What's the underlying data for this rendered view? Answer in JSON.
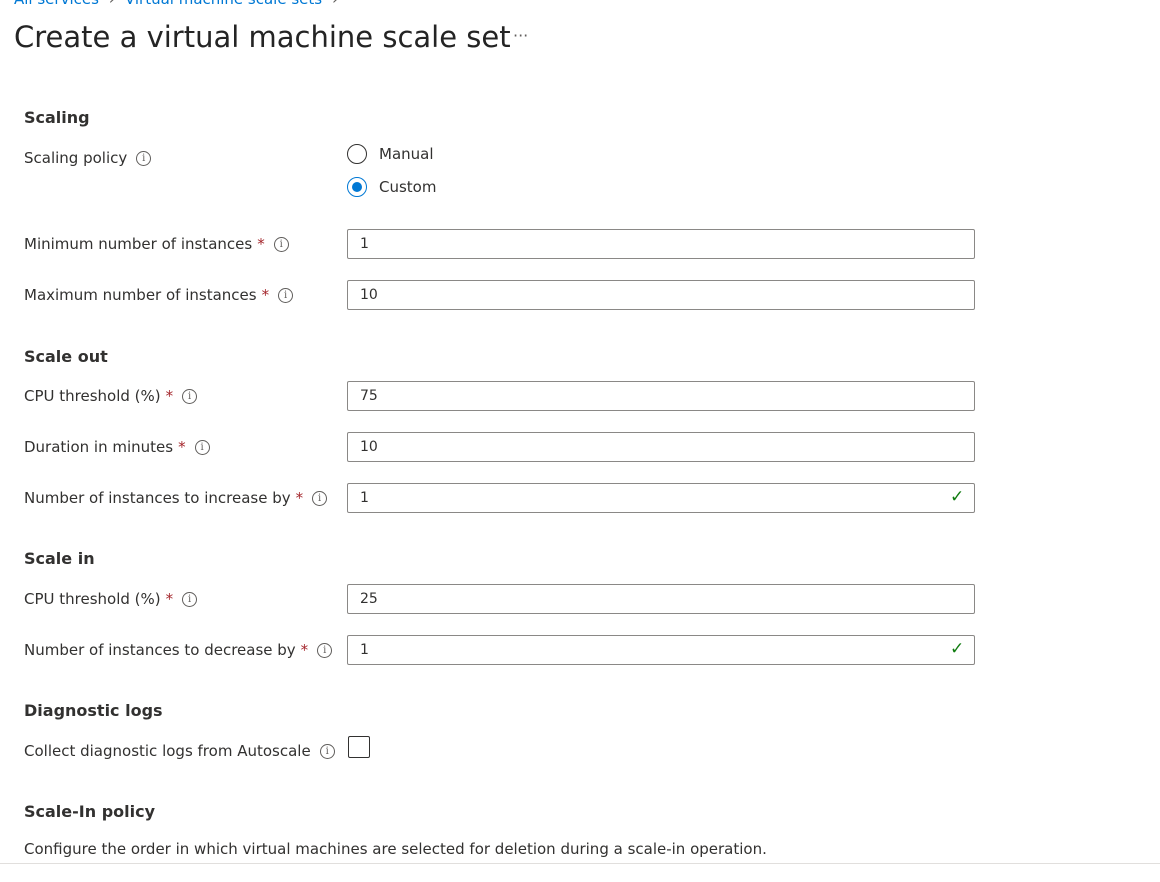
{
  "breadcrumb": [
    "All services",
    "Virtual machine scale sets"
  ],
  "title": "Create a virtual machine scale set",
  "more": "···",
  "scaling": {
    "heading": "Scaling",
    "policy_label": "Scaling policy",
    "options": [
      "Manual",
      "Custom"
    ],
    "selected": "Custom",
    "min_label": "Minimum number of instances",
    "min_value": "1",
    "max_label": "Maximum number of instances",
    "max_value": "10"
  },
  "scale_out": {
    "heading": "Scale out",
    "cpu_label": "CPU threshold (%)",
    "cpu_value": "75",
    "duration_label": "Duration in minutes",
    "duration_value": "10",
    "increase_label": "Number of instances to increase by",
    "increase_value": "1"
  },
  "scale_in": {
    "heading": "Scale in",
    "cpu_label": "CPU threshold (%)",
    "cpu_value": "25",
    "decrease_label": "Number of instances to decrease by",
    "decrease_value": "1"
  },
  "diagnostics": {
    "heading": "Diagnostic logs",
    "collect_label": "Collect diagnostic logs from Autoscale",
    "checked": false
  },
  "scale_in_policy": {
    "heading": "Scale-In policy",
    "description": "Configure the order in which virtual machines are selected for deletion during a scale-in operation."
  },
  "common": {
    "required": "*",
    "info": "i",
    "valid": "✓"
  }
}
